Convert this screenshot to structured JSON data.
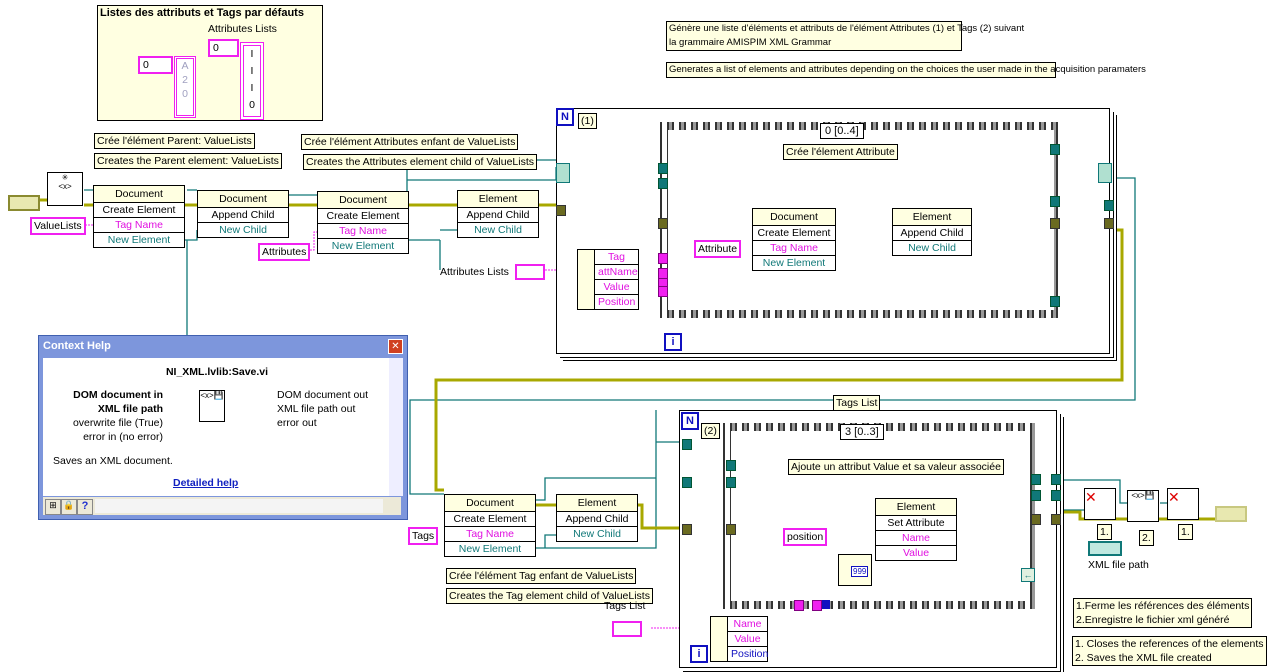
{
  "defaults_panel": {
    "title": "Listes des attributs et Tags par défauts",
    "attributes_label": "Attributes Lists",
    "tags_array": {
      "index": "0",
      "values": [
        "A",
        "2",
        "0"
      ]
    },
    "attributes_array": {
      "index": "0",
      "values": [
        "I",
        "I",
        "I",
        "0"
      ]
    }
  },
  "comments": {
    "parent_fr": "Crée l'élément Parent: ValueLists",
    "parent_en": "Creates the Parent element: ValueLists",
    "attributes_fr": "Crée l'élément Attributes enfant de ValueLists",
    "attributes_en": "Creates the Attributes element child of ValueLists",
    "summary_fr_1": "Génère une liste d'éléments et attributs de l'élément Attributes (1) et Tags (2) suivant",
    "summary_fr_2": "la grammaire AMISPIM XML Grammar",
    "summary_en": "Generates a list of elements and attributes depending on the choices the user made in the acquisition paramaters",
    "attribute_element": "Crée l'élement Attribute",
    "tags_list": "Tags List",
    "value_attribute": "Ajoute un attribut Value et sa valeur associée",
    "tag_fr": "Crée l'élément Tag enfant de ValueLists",
    "tag_en": "Creates the Tag element child of ValueLists",
    "close_fr_1": "1.Ferme les références des éléments",
    "close_fr_2": "2.Enregistre le fichier xml généré",
    "close_en_1": "1. Closes the references of the elements",
    "close_en_2": "2. Saves the XML file created",
    "step_1a": "1.",
    "step_2": "2.",
    "step_1b": "1."
  },
  "labels": {
    "attributes_lists": "Attributes Lists",
    "tags_list": "Tags List",
    "xml_file_path": "XML file path"
  },
  "constants": {
    "valuelists": "ValueLists",
    "attributes": "Attributes",
    "attribute": "Attribute",
    "tags": "Tags",
    "position": "position"
  },
  "nodes": {
    "create_parent": {
      "class": "Document",
      "method": "Create Element",
      "in": "Tag Name",
      "out": "New Element"
    },
    "append_parent": {
      "class": "Document",
      "method": "Append Child",
      "in": "New Child"
    },
    "create_attributes": {
      "class": "Document",
      "method": "Create Element",
      "in": "Tag Name",
      "out": "New Element"
    },
    "append_attributes": {
      "class": "Element",
      "method": "Append Child",
      "in": "New Child"
    },
    "create_attribute": {
      "class": "Document",
      "method": "Create Element",
      "in": "Tag Name",
      "out": "New Element"
    },
    "append_attribute": {
      "class": "Element",
      "method": "Append Child",
      "in": "New Child"
    },
    "create_tag": {
      "class": "Document",
      "method": "Create Element",
      "in": "Tag Name",
      "out": "New Element"
    },
    "append_tag": {
      "class": "Element",
      "method": "Append Child",
      "in": "New Child"
    },
    "set_attribute": {
      "class": "Element",
      "method": "Set Attribute",
      "in1": "Name",
      "in2": "Value"
    }
  },
  "loop1": {
    "n": "N",
    "i": "i",
    "label": "(1)",
    "case": "0 [0..4]",
    "unbundle": [
      "Tag",
      "attName",
      "Value",
      "Position"
    ]
  },
  "loop2": {
    "n": "N",
    "i": "i",
    "label": "(2)",
    "case": "3 [0..3]",
    "unbundle": [
      "Name",
      "Value",
      "Position"
    ],
    "format_constant": "999"
  },
  "context_help": {
    "title": "Context Help",
    "vi_name": "NI_XML.lvlib:Save.vi",
    "inputs": [
      "DOM document in",
      "XML file path",
      "overwrite file (True)",
      "error in (no error)"
    ],
    "outputs": [
      "DOM document out",
      "XML file path out",
      "error out"
    ],
    "description": "Saves an XML document.",
    "link": "Detailed help"
  },
  "colors": {
    "reference_wire": "#107878",
    "error_wire": "#a8a800",
    "string_wire": "#f020f0",
    "comment_bg": "#ffffe1",
    "help_titlebar": "#7d96dc"
  }
}
